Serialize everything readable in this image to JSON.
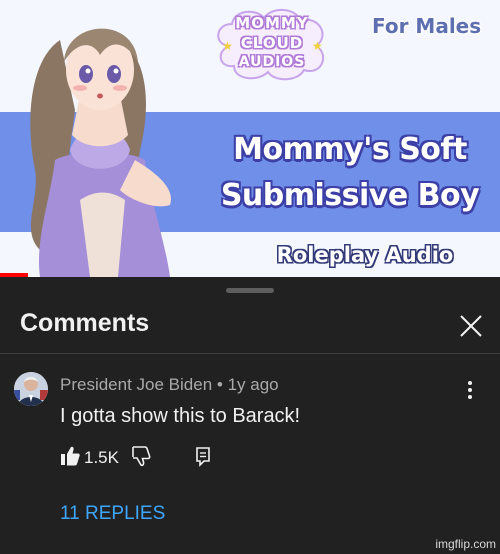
{
  "thumbnail": {
    "badge_lines": [
      "MOMMY",
      "CLOUD",
      "AUDIOS"
    ],
    "badge_line_1": "MOMMY",
    "badge_line_2": "CLOUD",
    "badge_line_3": "AUDIOS",
    "tag": "For Males",
    "title_line_1": "Mommy's Soft",
    "title_line_2": "Submissive Boy",
    "subtitle": "Roleplay Audio",
    "colors": {
      "band": "#6f8fe8",
      "background": "#f4f7fd",
      "progress": "#ff0000"
    }
  },
  "comments_panel": {
    "title": "Comments",
    "close_icon": "close-icon",
    "comment": {
      "author": "President Joe Biden",
      "separator": " • ",
      "age": "1y ago",
      "text": "I gotta show this to Barack!",
      "likes": "1.5K",
      "icons": [
        "thumbs-up-icon",
        "thumbs-down-icon",
        "reply-icon",
        "more-vert-icon"
      ],
      "replies_label": "11 REPLIES"
    },
    "colors": {
      "panel": "#212121",
      "link": "#3ea6ff",
      "text": "#f1f1f1",
      "muted": "#a9a9a9"
    }
  },
  "watermark": "imgflip.com"
}
